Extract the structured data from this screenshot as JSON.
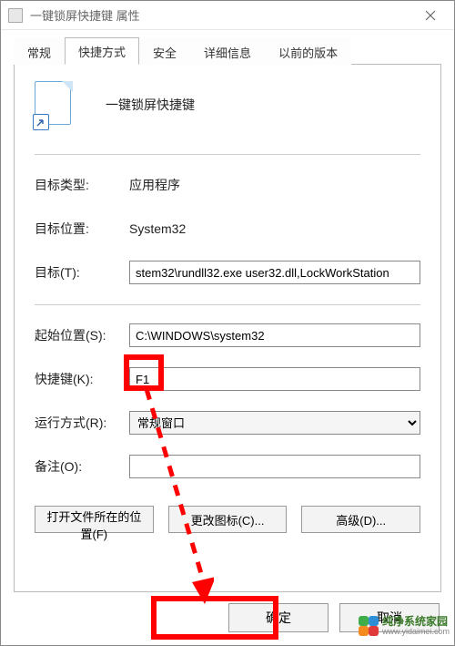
{
  "window": {
    "title": "一键锁屏快捷键 属性"
  },
  "tabs": {
    "general": "常规",
    "shortcut": "快捷方式",
    "security": "安全",
    "details": "详细信息",
    "previous": "以前的版本"
  },
  "shortcut": {
    "name": "一键锁屏快捷键"
  },
  "fields": {
    "targetType": {
      "label": "目标类型:",
      "value": "应用程序"
    },
    "targetLocation": {
      "label": "目标位置:",
      "value": "System32"
    },
    "target": {
      "label": "目标(T):",
      "value": "stem32\\rundll32.exe user32.dll,LockWorkStation"
    },
    "startIn": {
      "label": "起始位置(S):",
      "value": "C:\\WINDOWS\\system32"
    },
    "shortcutKey": {
      "label": "快捷键(K):",
      "value": "F1"
    },
    "run": {
      "label": "运行方式(R):",
      "value": "常规窗口"
    },
    "comment": {
      "label": "备注(O):",
      "value": ""
    }
  },
  "buttons": {
    "openLocation": "打开文件所在的位置(F)",
    "changeIcon": "更改图标(C)...",
    "advanced": "高级(D)...",
    "ok": "确定",
    "cancel": "取消"
  },
  "watermark": {
    "cn": "纯净系统家园",
    "url": "www.yidaimei.com"
  }
}
